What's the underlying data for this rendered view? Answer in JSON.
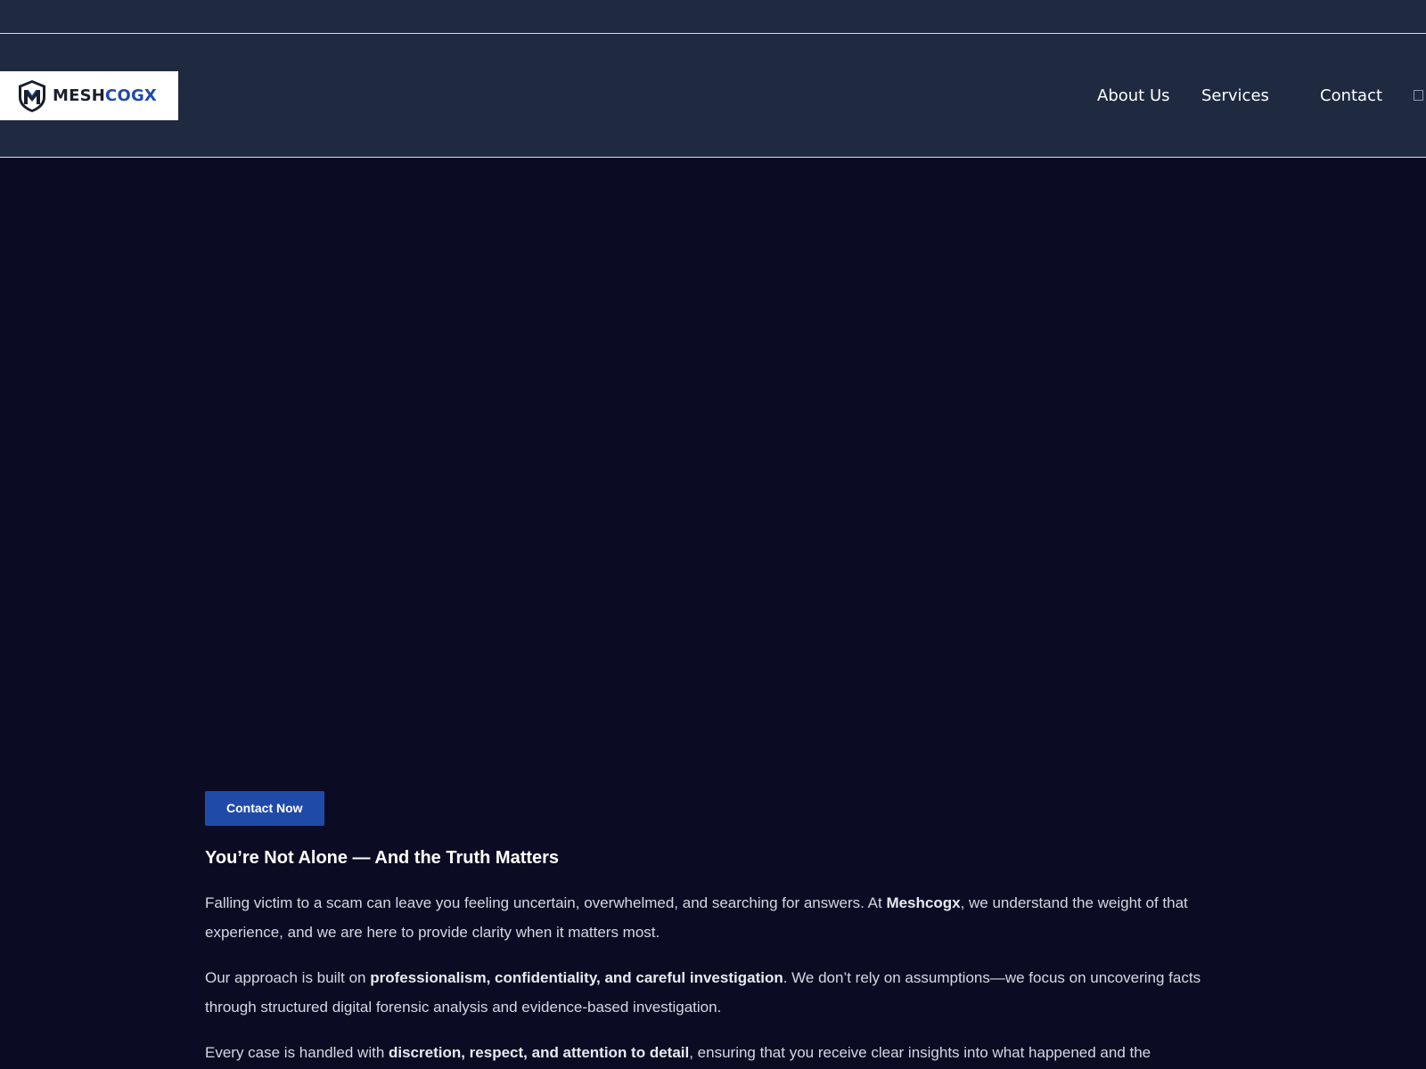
{
  "header": {
    "logo": {
      "text_part1": "MESH",
      "text_part2": "COGX",
      "icon": "shield-m-icon"
    },
    "nav": {
      "about": "About Us",
      "services": "Services",
      "contact": "Contact"
    },
    "extra_icon": "square-icon"
  },
  "hero": {
    "cta_label": "Contact Now"
  },
  "intro": {
    "heading": "You’re Not Alone — And the Truth Matters",
    "p1": {
      "a": "Falling victim to a scam can leave you feeling uncertain, overwhelmed, and searching for answers. At ",
      "b": "Meshcogx",
      "c": ", we understand the weight of that experience, and we are here to provide clarity when it matters most."
    },
    "p2": {
      "a": "Our approach is built on ",
      "b": "professionalism, confidentiality, and careful investigation",
      "c": ". We don’t rely on assumptions—we focus on uncovering facts through structured digital forensic analysis and evidence-based investigation."
    },
    "p3": {
      "a": "Every case is handled with ",
      "b": "discretion, respect, and attention to detail",
      "c": ", ensuring that you receive clear insights into what happened and the"
    }
  },
  "colors": {
    "background": "#0b0c24",
    "header_bg": "#1f2a40",
    "accent_blue": "#1f4aa8",
    "text_light": "#d5d8e0"
  }
}
